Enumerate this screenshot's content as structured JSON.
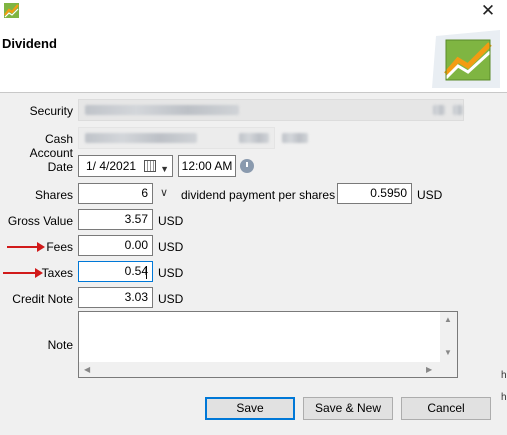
{
  "window": {
    "title": "Dividend",
    "close_glyph": "✕",
    "app_icon": "chart-app-icon",
    "header_logo": "trend-chart-logo"
  },
  "form": {
    "security": {
      "label": "Security",
      "value_hidden": true
    },
    "cash_account": {
      "label": "Cash Account",
      "value_hidden": true
    },
    "date": {
      "label": "Date",
      "value": "1/  4/2021",
      "time": "12:00 AM",
      "calendar_icon": "calendar-icon",
      "time_icon": "clock-icon"
    },
    "shares": {
      "label": "Shares",
      "value": "6",
      "per_label": "dividend payment per shares",
      "per_value": "0.5950",
      "unit": "USD"
    },
    "gross_value": {
      "label": "Gross Value",
      "value": "3.57",
      "unit": "USD"
    },
    "fees": {
      "label": "Fees",
      "value": "0.00",
      "unit": "USD"
    },
    "taxes": {
      "label": "Taxes",
      "value": "0.54",
      "unit": "USD"
    },
    "credit_note": {
      "label": "Credit Note",
      "value": "3.03",
      "unit": "USD"
    },
    "note": {
      "label": "Note",
      "value": ""
    }
  },
  "buttons": {
    "save": "Save",
    "save_new": "Save & New",
    "cancel": "Cancel"
  },
  "annotations": {
    "arrow_color": "#d11a1a"
  },
  "edge_fragments": [
    "h",
    "h"
  ]
}
